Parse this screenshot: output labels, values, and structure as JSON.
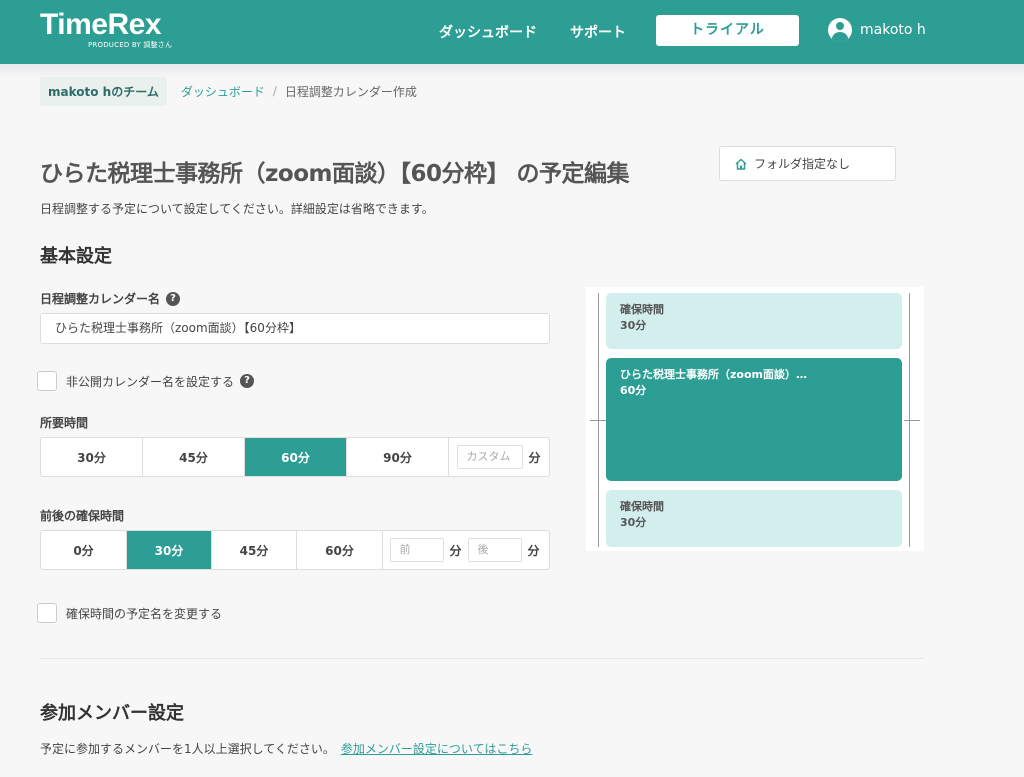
{
  "header": {
    "logo": "TimeRex",
    "logo_sub": "PRODUCED BY 調整さん",
    "nav": {
      "dashboard": "ダッシュボード",
      "support": "サポート"
    },
    "trial_label": "トライアル",
    "user_name": "makoto h"
  },
  "breadcrumb": {
    "team": "makoto hのチーム",
    "dashboard": "ダッシュボード",
    "current": "日程調整カレンダー作成"
  },
  "page": {
    "title": "ひらた税理士事務所（zoom面談）【60分枠】 の予定編集",
    "description": "日程調整する予定について設定してください。詳細設定は省略できます。",
    "folder_label": "フォルダ指定なし"
  },
  "basic": {
    "section_title": "基本設定",
    "calendar_name_label": "日程調整カレンダー名",
    "calendar_name_value": "ひらた税理士事務所（zoom面談）【60分枠】",
    "private_name_label": "非公開カレンダー名を設定する",
    "duration_label": "所要時間",
    "duration_options": [
      "30分",
      "45分",
      "60分",
      "90分"
    ],
    "duration_selected": "60分",
    "duration_custom_placeholder": "カスタム",
    "unit": "分",
    "buffer_label": "前後の確保時間",
    "buffer_options": [
      "0分",
      "30分",
      "45分",
      "60分"
    ],
    "buffer_selected": "30分",
    "buffer_before_placeholder": "前",
    "buffer_after_placeholder": "後",
    "buffer_rename_label": "確保時間の予定名を変更する"
  },
  "preview": {
    "buffer_title": "確保時間",
    "buffer_duration": "30分",
    "event_title": "ひらた税理士事務所（zoom面談）…",
    "event_duration": "60分"
  },
  "members": {
    "section_title": "参加メンバー設定",
    "description": "予定に参加するメンバーを1人以上選択してください。",
    "link": "参加メンバー設定についてはこちら"
  },
  "colors": {
    "accent": "#2d9e94",
    "light_accent": "#d3efed"
  }
}
